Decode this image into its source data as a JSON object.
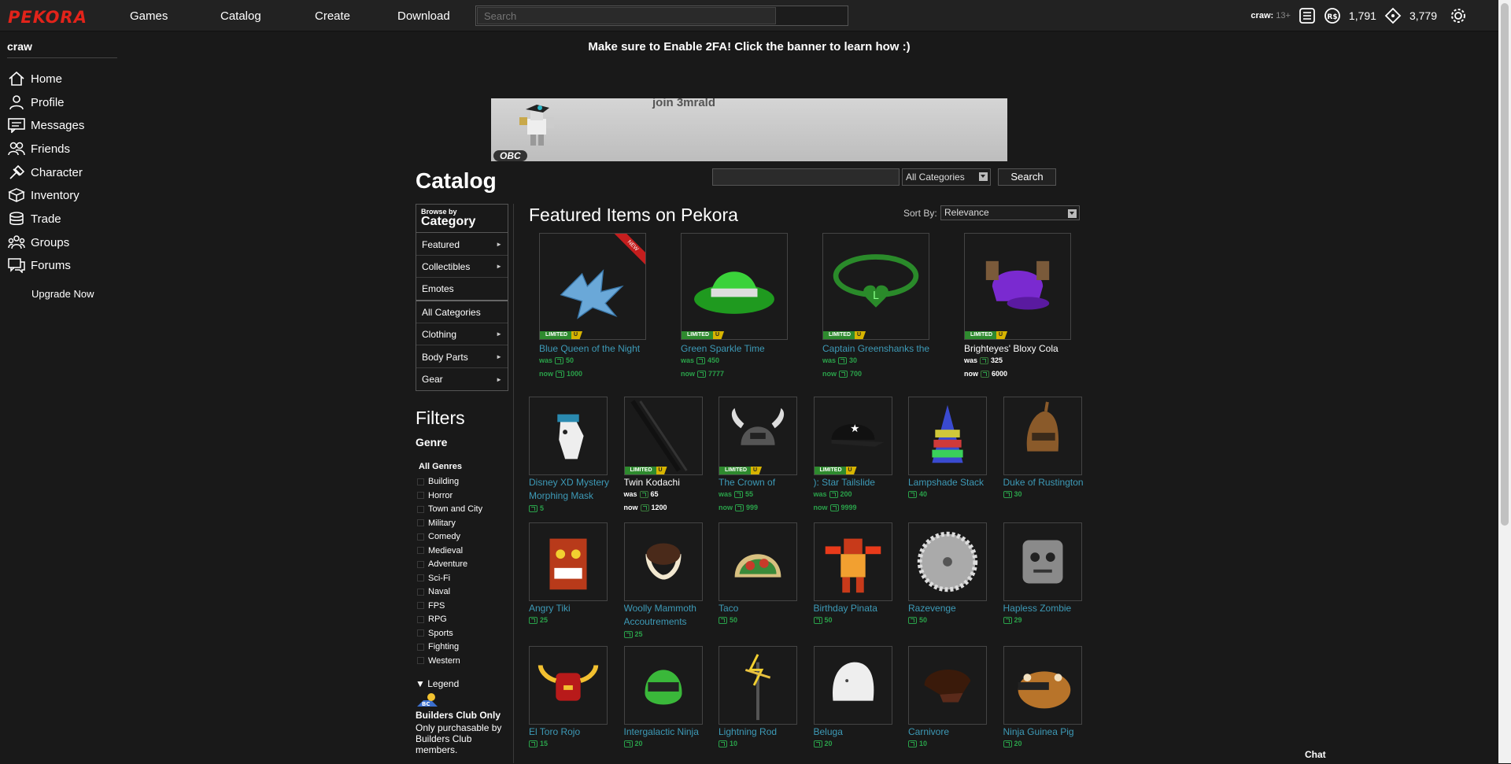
{
  "topbar": {
    "logo": "PEKORA",
    "nav": [
      "Games",
      "Catalog",
      "Create",
      "Download"
    ],
    "search_placeholder": "Search",
    "username": "craw",
    "age_tag": "13+",
    "robux": "1,791",
    "tickets": "3,779"
  },
  "sidebar": {
    "username": "craw",
    "items": [
      {
        "label": "Home",
        "icon": "home-icon"
      },
      {
        "label": "Profile",
        "icon": "profile-icon"
      },
      {
        "label": "Messages",
        "icon": "messages-icon"
      },
      {
        "label": "Friends",
        "icon": "friends-icon"
      },
      {
        "label": "Character",
        "icon": "character-icon"
      },
      {
        "label": "Inventory",
        "icon": "inventory-icon"
      },
      {
        "label": "Trade",
        "icon": "trade-icon"
      },
      {
        "label": "Groups",
        "icon": "groups-icon"
      },
      {
        "label": "Forums",
        "icon": "forums-icon"
      }
    ],
    "upgrade": "Upgrade Now"
  },
  "banner": {
    "message": "Make sure to Enable 2FA! Click the banner to learn how :)",
    "ad_text": "join 3mrald",
    "ad_tag": "OBC"
  },
  "catalog": {
    "title": "Catalog",
    "category_select": "All Categories",
    "search_button": "Search",
    "browse_by": "Browse by",
    "category_label": "Category",
    "categories": [
      {
        "label": "Featured",
        "arrow": "►"
      },
      {
        "label": "Collectibles",
        "arrow": "►"
      },
      {
        "label": "Emotes",
        "arrow": ""
      },
      {
        "label": "All Categories",
        "arrow": ""
      },
      {
        "label": "Clothing",
        "arrow": "►"
      },
      {
        "label": "Body Parts",
        "arrow": "►"
      },
      {
        "label": "Gear",
        "arrow": "►"
      }
    ],
    "filters_title": "Filters",
    "genre_title": "Genre",
    "all_genres": "All Genres",
    "genres": [
      "Building",
      "Horror",
      "Town and City",
      "Military",
      "Comedy",
      "Medieval",
      "Adventure",
      "Sci-Fi",
      "Naval",
      "FPS",
      "RPG",
      "Sports",
      "Fighting",
      "Western"
    ],
    "legend_title": "Legend",
    "legend_icon_text": "BC",
    "legend_heading": "Builders Club Only",
    "legend_desc": "Only purchasable by Builders Club members.",
    "featured_title": "Featured Items on Pekora",
    "sort_label": "Sort By:",
    "sort_value": "Relevance",
    "was_label": "was",
    "now_label": "now",
    "limited_label": "LIMITED",
    "u_label": "U",
    "new_label": "NEW"
  },
  "featured_items": [
    {
      "name": "Blue Queen of the Night",
      "was": "50",
      "now": "1000",
      "limited": true,
      "new": true,
      "white": false
    },
    {
      "name": "Green Sparkle Time",
      "was": "450",
      "now": "7777",
      "limited": true,
      "new": false,
      "white": false
    },
    {
      "name": "Captain Greenshanks the",
      "was": "30",
      "now": "700",
      "limited": true,
      "new": false,
      "white": false
    },
    {
      "name": "Brighteyes' Bloxy Cola",
      "was": "325",
      "now": "6000",
      "limited": true,
      "new": false,
      "white": true
    }
  ],
  "grid_items": [
    {
      "name": "Disney XD Mystery",
      "name2": "Morphing Mask",
      "price": "5"
    },
    {
      "name": "Twin Kodachi",
      "was": "65",
      "now": "1200",
      "limited": true,
      "white": true
    },
    {
      "name": "The Crown of",
      "was": "55",
      "now": "999",
      "limited": true
    },
    {
      "name": "): Star Tailslide",
      "was": "200",
      "now": "9999",
      "limited": true
    },
    {
      "name": "Lampshade Stack",
      "price": "40"
    },
    {
      "name": "Duke of Rustington",
      "price": "30"
    },
    {
      "name": "Angry Tiki",
      "price": "25"
    },
    {
      "name": "Woolly Mammoth",
      "name2": "Accoutrements",
      "price": "25"
    },
    {
      "name": "Taco",
      "price": "50"
    },
    {
      "name": "Birthday Pinata",
      "price": "50"
    },
    {
      "name": "Razevenge",
      "price": "50"
    },
    {
      "name": "Hapless Zombie",
      "price": "29"
    },
    {
      "name": "El Toro Rojo",
      "price": "15"
    },
    {
      "name": "Intergalactic Ninja",
      "price": "20"
    },
    {
      "name": "Lightning Rod",
      "price": "10"
    },
    {
      "name": "Beluga",
      "price": "20"
    },
    {
      "name": "Carnivore",
      "price": "10"
    },
    {
      "name": "Ninja Guinea Pig",
      "price": "20"
    }
  ],
  "chat": "Chat"
}
